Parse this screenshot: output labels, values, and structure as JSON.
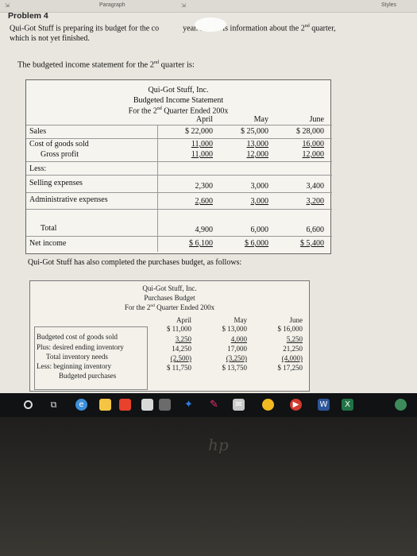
{
  "ribbon": {
    "left": "Paragraph",
    "right": "Styles"
  },
  "problem": {
    "title": "Problem 4",
    "intro_a": "Qui-Got Stuff is preparing its budget for the co",
    "intro_b": "year. Below is information about the 2",
    "intro_sup": "nd",
    "intro_c": " quarter,",
    "intro_d": "which is not yet finished."
  },
  "subtitle": {
    "a": "The budgeted income statement for the 2",
    "sup": "nd",
    "b": " quarter is:"
  },
  "income_statement": {
    "company": "Qui-Got Stuff, Inc.",
    "title": "Budgeted Income Statement",
    "period_a": "For the 2",
    "period_sup": "nd",
    "period_b": " Quarter Ended 200x",
    "months": [
      "April",
      "May",
      "June"
    ],
    "rows": [
      {
        "label": "Sales",
        "values": [
          "$ 22,000",
          "$ 25,000",
          "$ 28,000"
        ]
      },
      {
        "label": "Cost of goods sold",
        "values": [
          "11,000",
          "13,000",
          "16,000"
        ]
      },
      {
        "label": "Gross profit",
        "values": [
          "11,000",
          "12,000",
          "12,000"
        ]
      },
      {
        "label": "Less:",
        "values": [
          "",
          "",
          ""
        ]
      },
      {
        "label": "Selling expenses",
        "values": [
          "2,300",
          "3,000",
          "3,400"
        ]
      },
      {
        "label": "Administrative expenses",
        "values": [
          "2,600",
          "3,000",
          "3,200"
        ]
      },
      {
        "label": "Total",
        "values": [
          "4,900",
          "6,000",
          "6,600"
        ]
      },
      {
        "label": "Net income",
        "values": [
          "$ 6,100",
          "$ 6,000",
          "$ 5,400"
        ]
      }
    ]
  },
  "middle_text": "Qui-Got Stuff has also completed the purchases budget, as follows:",
  "purchases_budget": {
    "company": "Qui-Got Stuff, Inc.",
    "title": "Purchases Budget",
    "period_a": "For the 2",
    "period_sup": "nd",
    "period_b": " Quarter Ended 200x",
    "months": [
      "April",
      "May",
      "June"
    ],
    "rows": [
      {
        "label": "Budgeted cost of goods sold",
        "values": [
          "$ 11,000",
          "$ 13,000",
          "$ 16,000"
        ]
      },
      {
        "label": "Plus: desired ending inventory",
        "values": [
          "3,250",
          "4,000",
          "5,250"
        ]
      },
      {
        "label": "Total inventory needs",
        "values": [
          "14,250",
          "17,000",
          "21,250"
        ]
      },
      {
        "label": "Less: beginning inventory",
        "values": [
          "(2,500)",
          "(3,250)",
          "(4,000)"
        ]
      },
      {
        "label": "Budgeted purchases",
        "values": [
          "$ 11,750",
          "$ 13,750",
          "$ 17,250"
        ]
      }
    ]
  },
  "taskbar": {
    "icons": [
      "windows-icon",
      "cortana-icon",
      "task-view-icon",
      "edge-icon",
      "file-explorer-icon",
      "store-icon",
      "office-icon",
      "calendar-icon",
      "dropbox-icon",
      "app-icon",
      "mail-icon",
      "chrome-icon",
      "media-icon",
      "word-icon",
      "excel-icon",
      "user-icon"
    ],
    "colors": {
      "edge": "#3b8fd9",
      "office": "#e8412c",
      "dropbox": "#2f7fe0",
      "chrome": "#f2b920",
      "word": "#2b579a",
      "excel": "#217346"
    }
  },
  "bezel": {
    "logo": "hp"
  }
}
